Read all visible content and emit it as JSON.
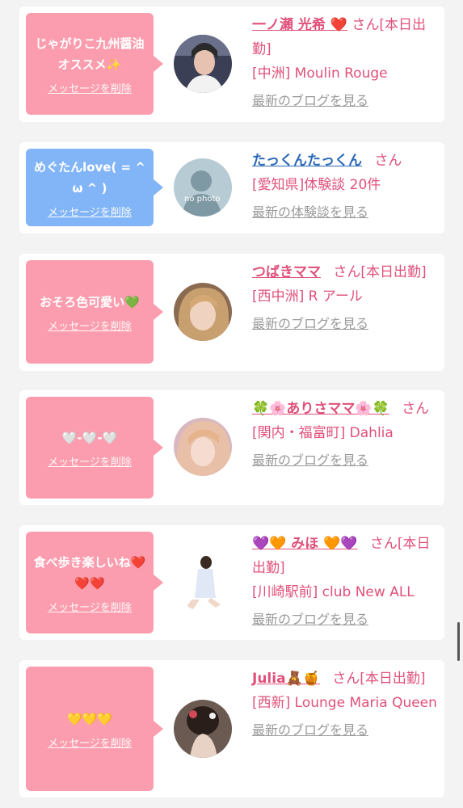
{
  "cards": [
    {
      "message": "じゃがりこ九州醤油オススメ✨",
      "delete_label": "メッセージを削除",
      "name": "一ノ瀬 光希 ❤️",
      "suffix": "さん[本日出勤]",
      "store": "[中洲] Moulin Rouge",
      "link": "最新のブログを見る"
    },
    {
      "message": "めぐたんlove( = ^ ω ^ )",
      "delete_label": "メッセージを削除",
      "name": "たっくんたっくん",
      "suffix": "さん",
      "store": "[愛知県]体験談 20件",
      "link": "最新の体験談を見る"
    },
    {
      "message": "おそろ色可愛い💚",
      "delete_label": "メッセージを削除",
      "name": "つばきママ",
      "suffix": "さん[本日出勤]",
      "store": "[西中洲] R アール",
      "link": "最新のブログを見る"
    },
    {
      "message": "🤍-🤍-🤍",
      "delete_label": "メッセージを削除",
      "name": "🍀🌸ありさママ🌸🍀",
      "suffix": "さん",
      "store": "[関内・福富町] Dahlia",
      "link": "最新のブログを見る"
    },
    {
      "message": "食べ歩き楽しいね❤️❤️❤️",
      "delete_label": "メッセージを削除",
      "name": "💜🧡 みほ 🧡💜",
      "suffix": "さん[本日出勤]",
      "store": "[川崎駅前] club New ALL",
      "link": "最新のブログを見る"
    },
    {
      "message": "💛💛💛",
      "delete_label": "メッセージを削除",
      "name": "Julia🧸🍯",
      "suffix": "さん[本日出勤]",
      "store": "[西新] Lounge Maria Queen",
      "link": "最新のブログを見る"
    }
  ],
  "no_photo_text": "no photo",
  "colors": {
    "pink_bubble": "#fb9dae",
    "blue_bubble": "#82b5f7",
    "accent": "#e0507a",
    "link_blue": "#2a68b8"
  }
}
